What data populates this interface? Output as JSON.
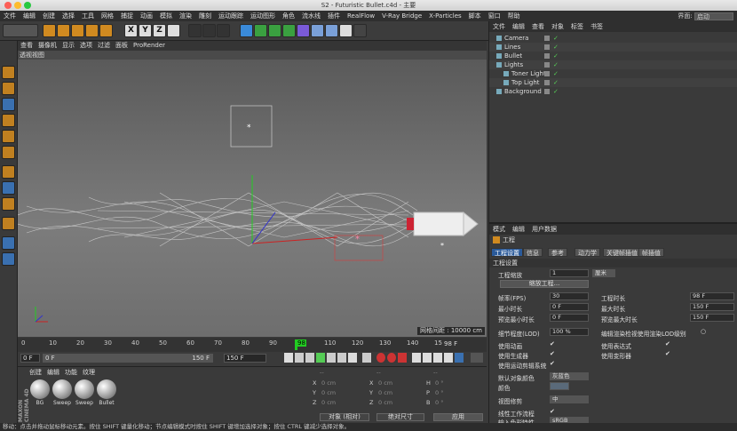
{
  "window": {
    "title": "S2 - Futuristic Bullet.c4d - 主要"
  },
  "menubar": {
    "items": [
      "文件",
      "编辑",
      "创建",
      "选择",
      "工具",
      "网格",
      "捕捉",
      "动画",
      "模拟",
      "渲染",
      "雕刻",
      "运动跟踪",
      "运动图形",
      "角色",
      "流水线",
      "插件",
      "RealFlow",
      "V-Ray Bridge",
      "X-Particles",
      "脚本",
      "窗口",
      "帮助"
    ],
    "layout_label": "界面:",
    "layout_value": "启动"
  },
  "toolbar": {
    "axis_x": "X",
    "axis_y": "Y",
    "axis_z": "Z"
  },
  "viewport": {
    "menu": [
      "查看",
      "摄像机",
      "显示",
      "选项",
      "过滤",
      "面板",
      "ProRender"
    ],
    "title": "透视视图",
    "grid_info": "网格间距 : 10000 cm"
  },
  "timeline": {
    "ticks": [
      "0",
      "10",
      "20",
      "30",
      "40",
      "50",
      "60",
      "70",
      "80",
      "90",
      "98",
      "110",
      "120",
      "130",
      "140",
      "150"
    ],
    "current_frame": "98 F"
  },
  "transport": {
    "start": "0 F",
    "slider_start": "0 F",
    "slider_end": "150 F",
    "end": "150 F"
  },
  "materials": {
    "menu": [
      "创建",
      "编辑",
      "功能",
      "纹理"
    ],
    "items": [
      "BG",
      "Sweep",
      "Sweep",
      "Bullet"
    ],
    "brand": "MAXON CINEMA 4D"
  },
  "coordinates": {
    "header_dashes": [
      "--",
      "--",
      "--"
    ],
    "rows": [
      {
        "a": "X",
        "av": "0 cm",
        "b": "X",
        "bv": "0 cm",
        "c": "H",
        "cv": "0 °"
      },
      {
        "a": "Y",
        "av": "0 cm",
        "b": "Y",
        "bv": "0 cm",
        "c": "P",
        "cv": "0 °"
      },
      {
        "a": "Z",
        "av": "0 cm",
        "b": "Z",
        "bv": "0 cm",
        "c": "B",
        "cv": "0 °"
      }
    ],
    "mode": "对象 (相对)",
    "size_mode": "绝对尺寸",
    "apply": "应用"
  },
  "object_manager": {
    "menu": [
      "文件",
      "编辑",
      "查看",
      "对象",
      "标签",
      "书签"
    ],
    "objects": [
      {
        "name": "Camera",
        "indent": 0
      },
      {
        "name": "Lines",
        "indent": 0
      },
      {
        "name": "Bullet",
        "indent": 0
      },
      {
        "name": "Lights",
        "indent": 0
      },
      {
        "name": "Toner Light",
        "indent": 1
      },
      {
        "name": "Top Light",
        "indent": 1
      },
      {
        "name": "Background",
        "indent": 0
      }
    ]
  },
  "attributes": {
    "menu": [
      "模式",
      "编辑",
      "用户数据"
    ],
    "header": "工程",
    "tabs": [
      "工程设置",
      "信息",
      "参考",
      "动力学",
      "关键帧插值",
      "帧插值"
    ],
    "section": "工程设置",
    "project_scale_label": "工程缩放",
    "project_scale_value": "1",
    "project_scale_unit": "厘米",
    "scale_button": "缩放工程...",
    "fps_label": "帧率(FPS)",
    "fps_value": "30",
    "project_time_label": "工程时长",
    "project_time_value": "98 F",
    "min_time_label": "最小时长",
    "min_time_value": "0 F",
    "max_time_label": "最大时长",
    "max_time_value": "150 F",
    "preview_min_label": "预览最小时长",
    "preview_min_value": "0 F",
    "preview_max_label": "预览最大时长",
    "preview_max_value": "150 F",
    "lod_label": "细节程度(LOD)",
    "lod_value": "100 %",
    "lod_render_label": "编辑渲染检视使用渲染LOD级别",
    "use_anim": "使用动画",
    "use_expr": "使用表达式",
    "use_gen": "使用生成器",
    "use_deform": "使用变形器",
    "use_motion": "使用运动剪辑系统",
    "default_color_label": "默认对象颜色",
    "default_color_value": "灰蓝色",
    "color_label": "颜色",
    "view_clip_label": "视图修剪",
    "view_clip_value": "中",
    "linear_label": "线性工作流程",
    "input_color_label": "输入色彩特性",
    "input_color_value": "sRGB"
  },
  "status": {
    "text": "移动：点击并拖动鼠标移动元素。按住 SHIFT 键量化移动；节点编辑模式时按住 SHIFT 键增加选择对象；按住 CTRL 键减少选择对象。"
  }
}
